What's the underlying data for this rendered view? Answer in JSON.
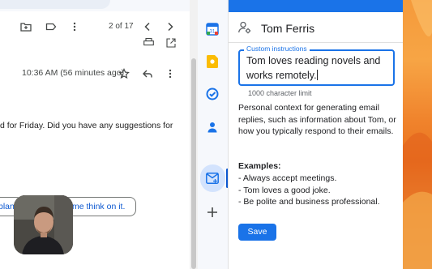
{
  "gmail": {
    "pagination": "2 of 17",
    "timestamp": "10:36 AM (56 minutes ago)",
    "body_line": "d for Friday. Did you have any suggestions for",
    "smart_reply_1": "plan",
    "smart_reply_2": "me think on it."
  },
  "side_panel": {
    "apps": [
      "calendar-icon",
      "keep-icon",
      "tasks-icon",
      "contacts-icon",
      "addon-icon",
      "add-icon"
    ],
    "calendar_day": "31"
  },
  "addon": {
    "title": "Tom Ferris",
    "custom_instructions_label": "Custom instructions",
    "custom_instructions_value": "Tom loves reading novels and works remotely.",
    "char_limit": "1000 character limit",
    "description": "Personal context for generating email replies, such as information about Tom, or how you typically respond to their emails.",
    "examples_title": "Examples:",
    "examples": [
      "- Always accept meetings.",
      "- Tom loves a good joke.",
      "- Be polite and business professional."
    ],
    "save_label": "Save"
  },
  "colors": {
    "accent": "#1a73e8",
    "gmail_blue": "#0b57d0"
  }
}
